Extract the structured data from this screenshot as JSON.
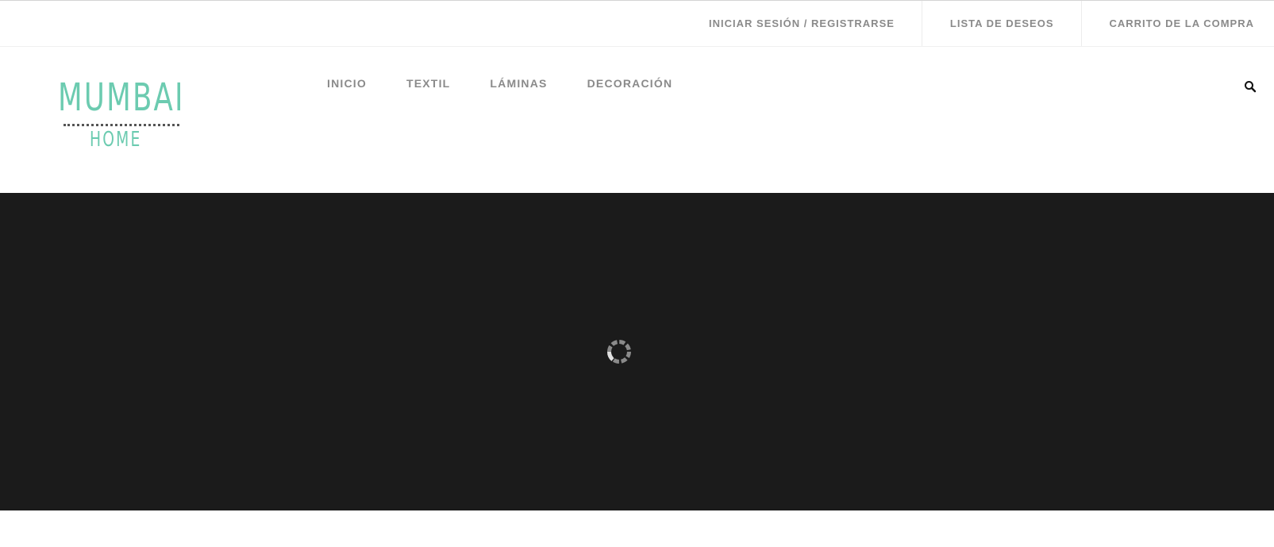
{
  "topbar": {
    "links": [
      {
        "label": "INICIAR SESIÓN / REGISTRARSE"
      },
      {
        "label": "LISTA DE DESEOS"
      },
      {
        "label": "CARRITO DE LA COMPRA"
      }
    ]
  },
  "logo": {
    "main": "MUMBAI",
    "sub": "HOME"
  },
  "nav": {
    "items": [
      {
        "label": "INICIO"
      },
      {
        "label": "TEXTIL"
      },
      {
        "label": "LÁMINAS"
      },
      {
        "label": "DECORACIÓN"
      }
    ]
  },
  "icons": {
    "search": "search-icon",
    "loader": "loading-spinner-icon"
  },
  "colors": {
    "brand": "#6ccbb0",
    "nav_text": "#8a8a8a",
    "slider_bg": "#1b1b1b"
  }
}
